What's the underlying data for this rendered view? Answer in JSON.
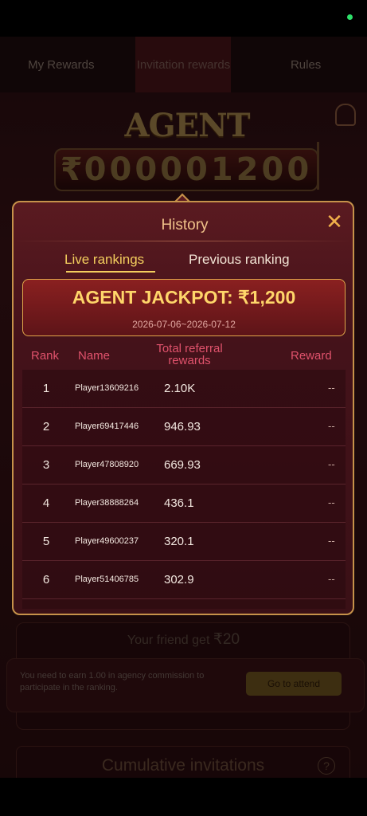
{
  "tabs": [
    {
      "label": "My Rewards"
    },
    {
      "label": "Invitation rewards"
    },
    {
      "label": "Rules"
    }
  ],
  "banner": {
    "title": "AGENT JACKPOT",
    "currency": "₹",
    "digits": "000001200"
  },
  "background": {
    "friend_get_label": "Your friend get ",
    "friend_get_amount": "₹20",
    "notice_text": "You need to earn 1.00 in agency commission to participate in the ranking.",
    "attend_label": "Go to attend",
    "cumulative_label": "Cumulative invitations",
    "help_symbol": "?"
  },
  "modal": {
    "title": "History",
    "close_symbol": "✕",
    "subtabs": {
      "live": "Live rankings",
      "previous": "Previous ranking"
    },
    "jackpot_title": "AGENT JACKPOT: ₹1,200",
    "date_range": "2026-07-06~2026-07-12",
    "columns": {
      "rank": "Rank",
      "name": "Name",
      "total": "Total referral rewards",
      "reward": "Reward"
    },
    "rows": [
      {
        "rank": "1",
        "name": "Player13609216",
        "total": "2.10K",
        "reward": "--"
      },
      {
        "rank": "2",
        "name": "Player69417446",
        "total": "946.93",
        "reward": "--"
      },
      {
        "rank": "3",
        "name": "Player47808920",
        "total": "669.93",
        "reward": "--"
      },
      {
        "rank": "4",
        "name": "Player38888264",
        "total": "436.1",
        "reward": "--"
      },
      {
        "rank": "5",
        "name": "Player49600237",
        "total": "320.1",
        "reward": "--"
      },
      {
        "rank": "6",
        "name": "Player51406785",
        "total": "302.9",
        "reward": "--"
      }
    ]
  },
  "colors": {
    "accent_gold": "#f4cf5e",
    "header_red": "#e0526c",
    "modal_border": "#c6924a"
  }
}
